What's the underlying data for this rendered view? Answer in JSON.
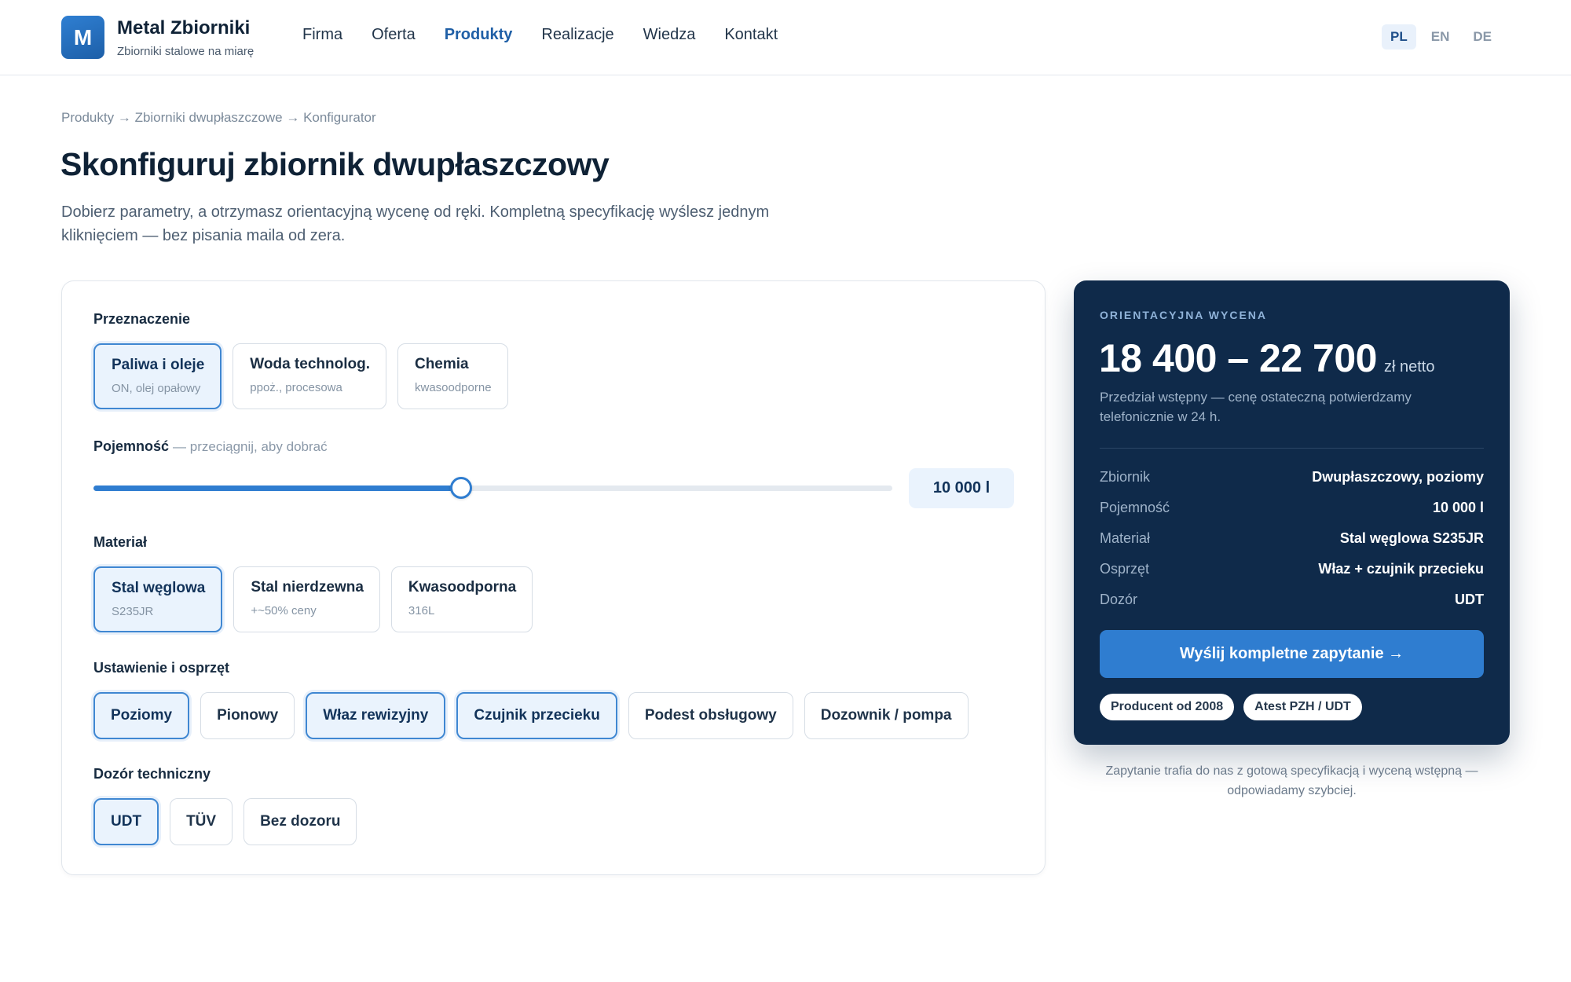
{
  "header": {
    "logo_letter": "M",
    "brand_name": "Metal Zbiorniki",
    "brand_tagline": "Zbiorniki stalowe na miarę",
    "nav": [
      {
        "label": "Firma"
      },
      {
        "label": "Oferta"
      },
      {
        "label": "Produkty",
        "active": true
      },
      {
        "label": "Realizacje"
      },
      {
        "label": "Wiedza"
      },
      {
        "label": "Kontakt"
      }
    ],
    "languages": [
      {
        "label": "PL",
        "active": true
      },
      {
        "label": "EN"
      },
      {
        "label": "DE"
      }
    ]
  },
  "breadcrumb": [
    "Produkty",
    "Zbiorniki dwupłaszczowe",
    "Konfigurator"
  ],
  "breadcrumb_separator": "→",
  "page": {
    "title": "Skonfiguruj zbiornik dwupłaszczowy",
    "lead": "Dobierz parametry, a otrzymasz orientacyjną wycenę od ręki. Kompletną specyfikację wyślesz jednym kliknięciem — bez pisania maila od zera."
  },
  "configurator": {
    "purpose": {
      "label": "Przeznaczenie",
      "options": [
        {
          "title": "Paliwa i oleje",
          "sub": "ON, olej opałowy",
          "selected": true
        },
        {
          "title": "Woda technolog.",
          "sub": "ppoż., procesowa",
          "selected": false
        },
        {
          "title": "Chemia",
          "sub": "kwasoodporne",
          "selected": false
        }
      ]
    },
    "capacity": {
      "label": "Pojemność",
      "hint": "— przeciągnij, aby dobrać",
      "value_text": "10 000 l",
      "fill_fraction": 0.46
    },
    "material": {
      "label": "Materiał",
      "options": [
        {
          "title": "Stal węglowa",
          "sub": "S235JR",
          "selected": true
        },
        {
          "title": "Stal nierdzewna",
          "sub": "+~50% ceny",
          "selected": false
        },
        {
          "title": "Kwasoodporna",
          "sub": "316L",
          "selected": false
        }
      ]
    },
    "setup": {
      "label": "Ustawienie i osprzęt",
      "options": [
        {
          "label": "Poziomy",
          "selected": true
        },
        {
          "label": "Pionowy",
          "selected": false
        },
        {
          "label": "Właz rewizyjny",
          "selected": true
        },
        {
          "label": "Czujnik przecieku",
          "selected": true
        },
        {
          "label": "Podest obsługowy",
          "selected": false
        },
        {
          "label": "Dozownik / pompa",
          "selected": false
        }
      ]
    },
    "inspection": {
      "label": "Dozór techniczny",
      "options": [
        {
          "label": "UDT",
          "selected": true
        },
        {
          "label": "TÜV",
          "selected": false
        },
        {
          "label": "Bez dozoru",
          "selected": false
        }
      ]
    }
  },
  "quote": {
    "eyebrow": "ORIENTACYJNA WYCENA",
    "price": "18 400 – 22 700",
    "price_unit": "zł netto",
    "note": "Przedział wstępny — cenę ostateczną potwierdzamy telefonicznie w 24 h.",
    "rows": [
      {
        "key": "Zbiornik",
        "value": "Dwupłaszczowy, poziomy"
      },
      {
        "key": "Pojemność",
        "value": "10 000 l"
      },
      {
        "key": "Materiał",
        "value": "Stal węglowa S235JR"
      },
      {
        "key": "Osprzęt",
        "value": "Właz + czujnik przecieku"
      },
      {
        "key": "Dozór",
        "value": "UDT"
      }
    ],
    "button_label": "Wyślij kompletne zapytanie →",
    "badges": [
      "Producent od 2008",
      "Atest PZH / UDT"
    ],
    "footnote": "Zapytanie trafia do nas z gotową specyfikacją i wyceną wstępną — odpowiadamy szybciej."
  },
  "colors": {
    "accent": "#2f7dd0",
    "quote_bg": "#0f2a4a",
    "selected_bg": "#eaf3fd"
  }
}
